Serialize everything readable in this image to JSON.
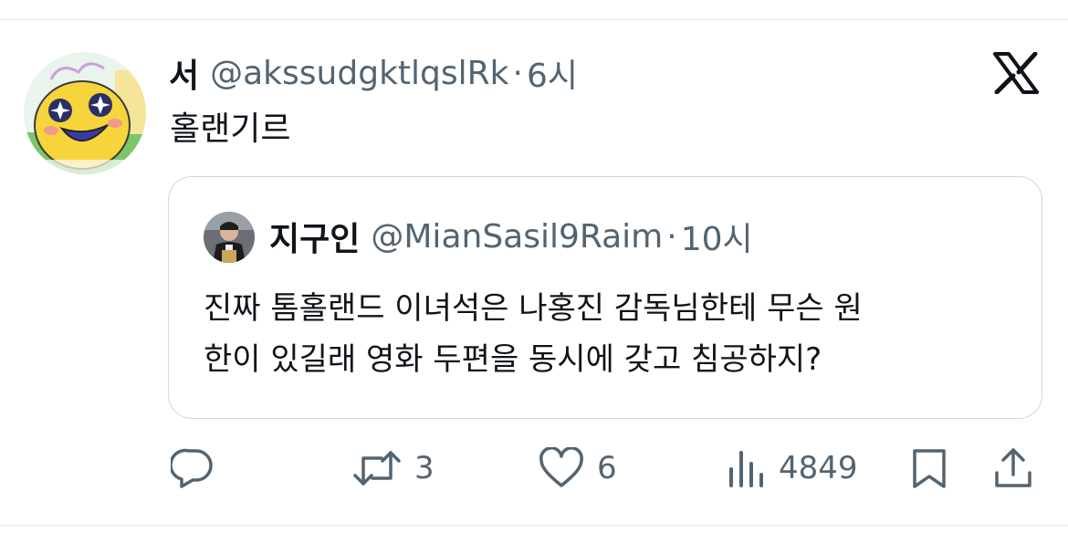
{
  "tweet": {
    "author_name": "서",
    "author_handle": "@akssudgktlqslRk",
    "separator": "·",
    "time": "6시",
    "text": "홀랜기르"
  },
  "quoted_tweet": {
    "author_name": "지구인",
    "author_handle": "@MianSasil9Raim",
    "separator": "·",
    "time": "10시",
    "text_line_1": "진짜 톰홀랜드 이녀석은 나홍진 감독님한테 무슨 원",
    "text_line_2": "한이 있길래 영화 두편을 동시에 갖고 침공하지?"
  },
  "actions": {
    "retweets": "3",
    "likes": "6",
    "views": "4849"
  },
  "icons": [
    "x-logo-icon",
    "reply-icon",
    "retweet-icon",
    "heart-icon",
    "views-icon",
    "bookmark-icon",
    "share-icon"
  ],
  "colors": {
    "text": "#0f1419",
    "secondary": "#536471",
    "border": "#cfd9de"
  }
}
